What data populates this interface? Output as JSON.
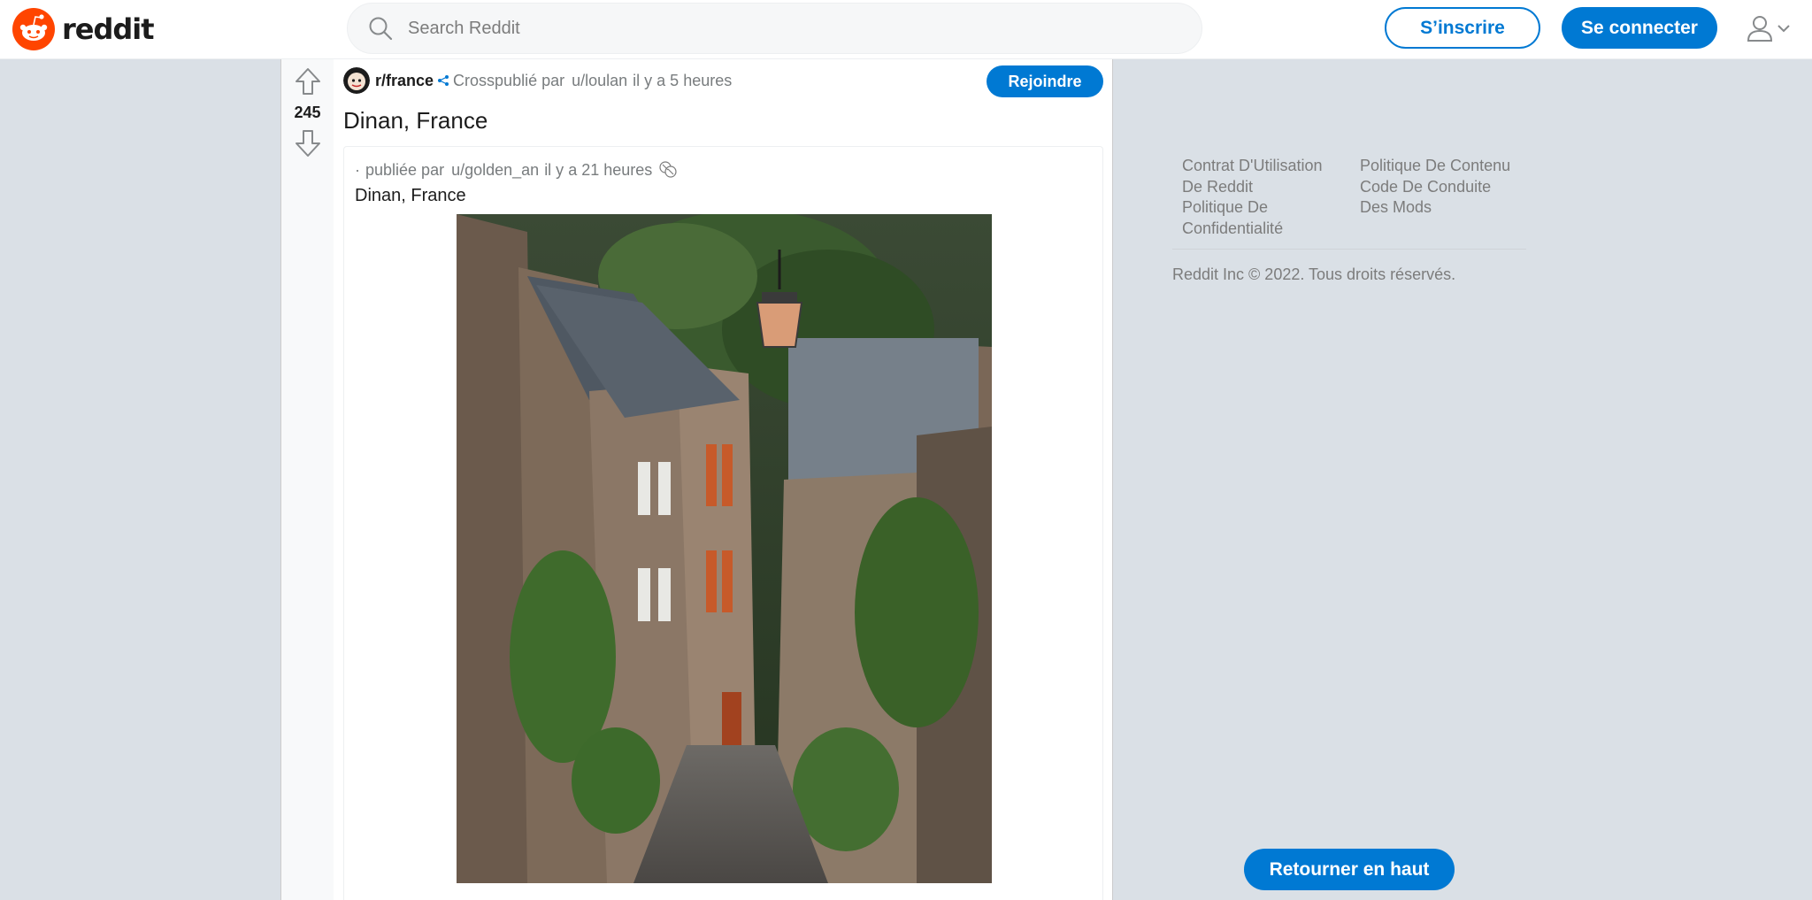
{
  "header": {
    "logo_text": "reddit",
    "search": {
      "placeholder": "Search Reddit"
    },
    "signup_label": "S’inscrire",
    "login_label": "Se connecter"
  },
  "post": {
    "votes": "245",
    "subreddit": "r/france",
    "crosspost_label": "Crosspublié par",
    "user": "u/loulan",
    "time": "il y a 5 heures",
    "join_label": "Rejoindre",
    "title": "Dinan, France",
    "original": {
      "dot": "·",
      "posted_label": "publiée par",
      "user": "u/golden_an",
      "time": "il y a 21 heures",
      "title": "Dinan, France"
    }
  },
  "footer": {
    "col1": [
      "Contrat D'Utilisation",
      "De Reddit",
      "Politique De",
      "Confidentialité"
    ],
    "col2": [
      "Politique De Contenu",
      "Code De Conduite",
      "Des Mods"
    ],
    "copyright": "Reddit Inc © 2022. Tous droits réservés."
  },
  "back_to_top_label": "Retourner en haut",
  "colors": {
    "accent": "#0079d3",
    "brand": "#ff4500",
    "page_bg": "#dae0e6"
  },
  "icons": [
    "reddit-logo-icon",
    "search-icon",
    "user-icon",
    "chevron-down-icon",
    "upvote-icon",
    "downvote-icon",
    "crosspost-icon",
    "award-icon"
  ]
}
